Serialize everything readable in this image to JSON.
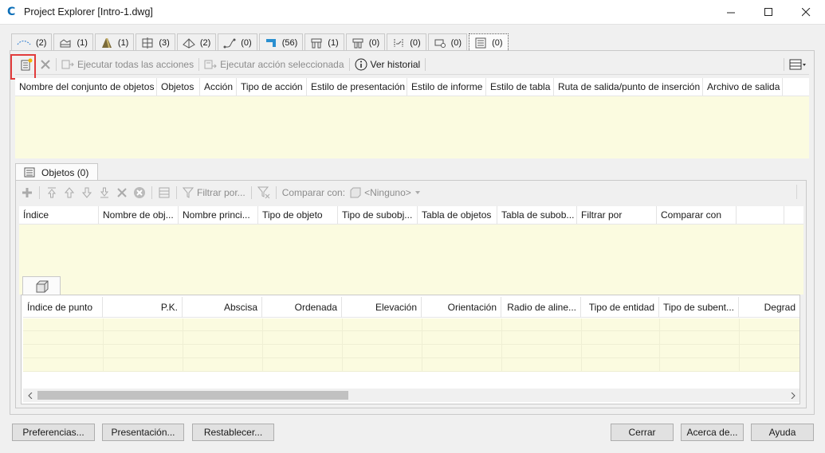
{
  "window": {
    "title": "Project Explorer [Intro-1.dwg]"
  },
  "tabs": [
    {
      "count": "(2)",
      "icon": "alignment-icon"
    },
    {
      "count": "(1)",
      "icon": "profile-icon"
    },
    {
      "count": "(1)",
      "icon": "corridor-icon"
    },
    {
      "count": "(3)",
      "icon": "assembly-icon"
    },
    {
      "count": "(2)",
      "icon": "surface-icon"
    },
    {
      "count": "(0)",
      "icon": "feature-line-icon"
    },
    {
      "count": "(56)",
      "icon": "point-icon"
    },
    {
      "count": "(1)",
      "icon": "pipe-network-icon"
    },
    {
      "count": "(0)",
      "icon": "pressure-network-icon"
    },
    {
      "count": "(0)",
      "icon": "section-icon"
    },
    {
      "count": "(0)",
      "icon": "parcel-icon"
    },
    {
      "count": "(0)",
      "icon": "object-set-icon"
    }
  ],
  "toolbar": {
    "run_all": "Ejecutar todas las acciones",
    "run_selected": "Ejecutar acción seleccionada",
    "history": "Ver historial"
  },
  "object_sets_table": {
    "columns": [
      "Nombre del conjunto de objetos",
      "Objetos",
      "Acción",
      "Tipo de acción",
      "Estilo de presentación",
      "Estilo de informe",
      "Estilo de tabla",
      "Ruta de salida/punto de inserción",
      "Archivo de salida"
    ]
  },
  "objects_panel": {
    "tab_label": "Objetos (0)",
    "filter_label": "Filtrar por...",
    "compare_label": "Comparar con:",
    "compare_value": "<Ninguno>",
    "columns": [
      "Índice",
      "Nombre de obj...",
      "Nombre princi...",
      "Tipo de objeto",
      "Tipo de subobj...",
      "Tabla de objetos",
      "Tabla de subob...",
      "Filtrar por",
      "Comparar con"
    ]
  },
  "points_table": {
    "columns": [
      "Índice de punto",
      "P.K.",
      "Abscisa",
      "Ordenada",
      "Elevación",
      "Orientación",
      "Radio de aline...",
      "Tipo de entidad",
      "Tipo de subent...",
      "Degrad"
    ]
  },
  "buttons": {
    "preferences": "Preferencias...",
    "presentation": "Presentación...",
    "reset": "Restablecer...",
    "close": "Cerrar",
    "about": "Acerca de...",
    "help": "Ayuda"
  },
  "colors": {
    "grid_fill": "#fbfbe0",
    "highlight": "#e23b3b",
    "brand": "#0d6fb8"
  }
}
